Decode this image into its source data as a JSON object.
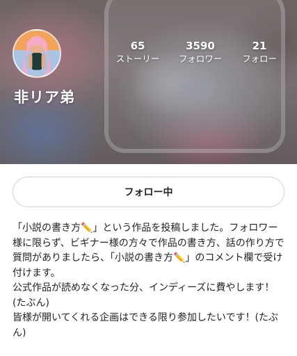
{
  "profile": {
    "username": "非リア弟",
    "avatar": "avatar-illustration"
  },
  "stats": {
    "stories": {
      "value": "65",
      "label": "ストーリー"
    },
    "followers": {
      "value": "3590",
      "label": "フォロワー"
    },
    "following": {
      "value": "21",
      "label": "フォロー"
    }
  },
  "follow_button": {
    "label": "フォロー中"
  },
  "bio": {
    "line1": "「小説の書き方✏️」という作品を投稿しました。フォロワー様に限らず、ビギナー様の方々で作品の書き方、話の作り方で質問がありましたら、「小説の書き方✏️」のコメント欄で受け付けます。",
    "line2": "公式作品が読めなくなった分、インディーズに費やします！(たぶん)",
    "line3": "皆様が開いてくれる企画はできる限り参加したいです！(たぶん)"
  }
}
